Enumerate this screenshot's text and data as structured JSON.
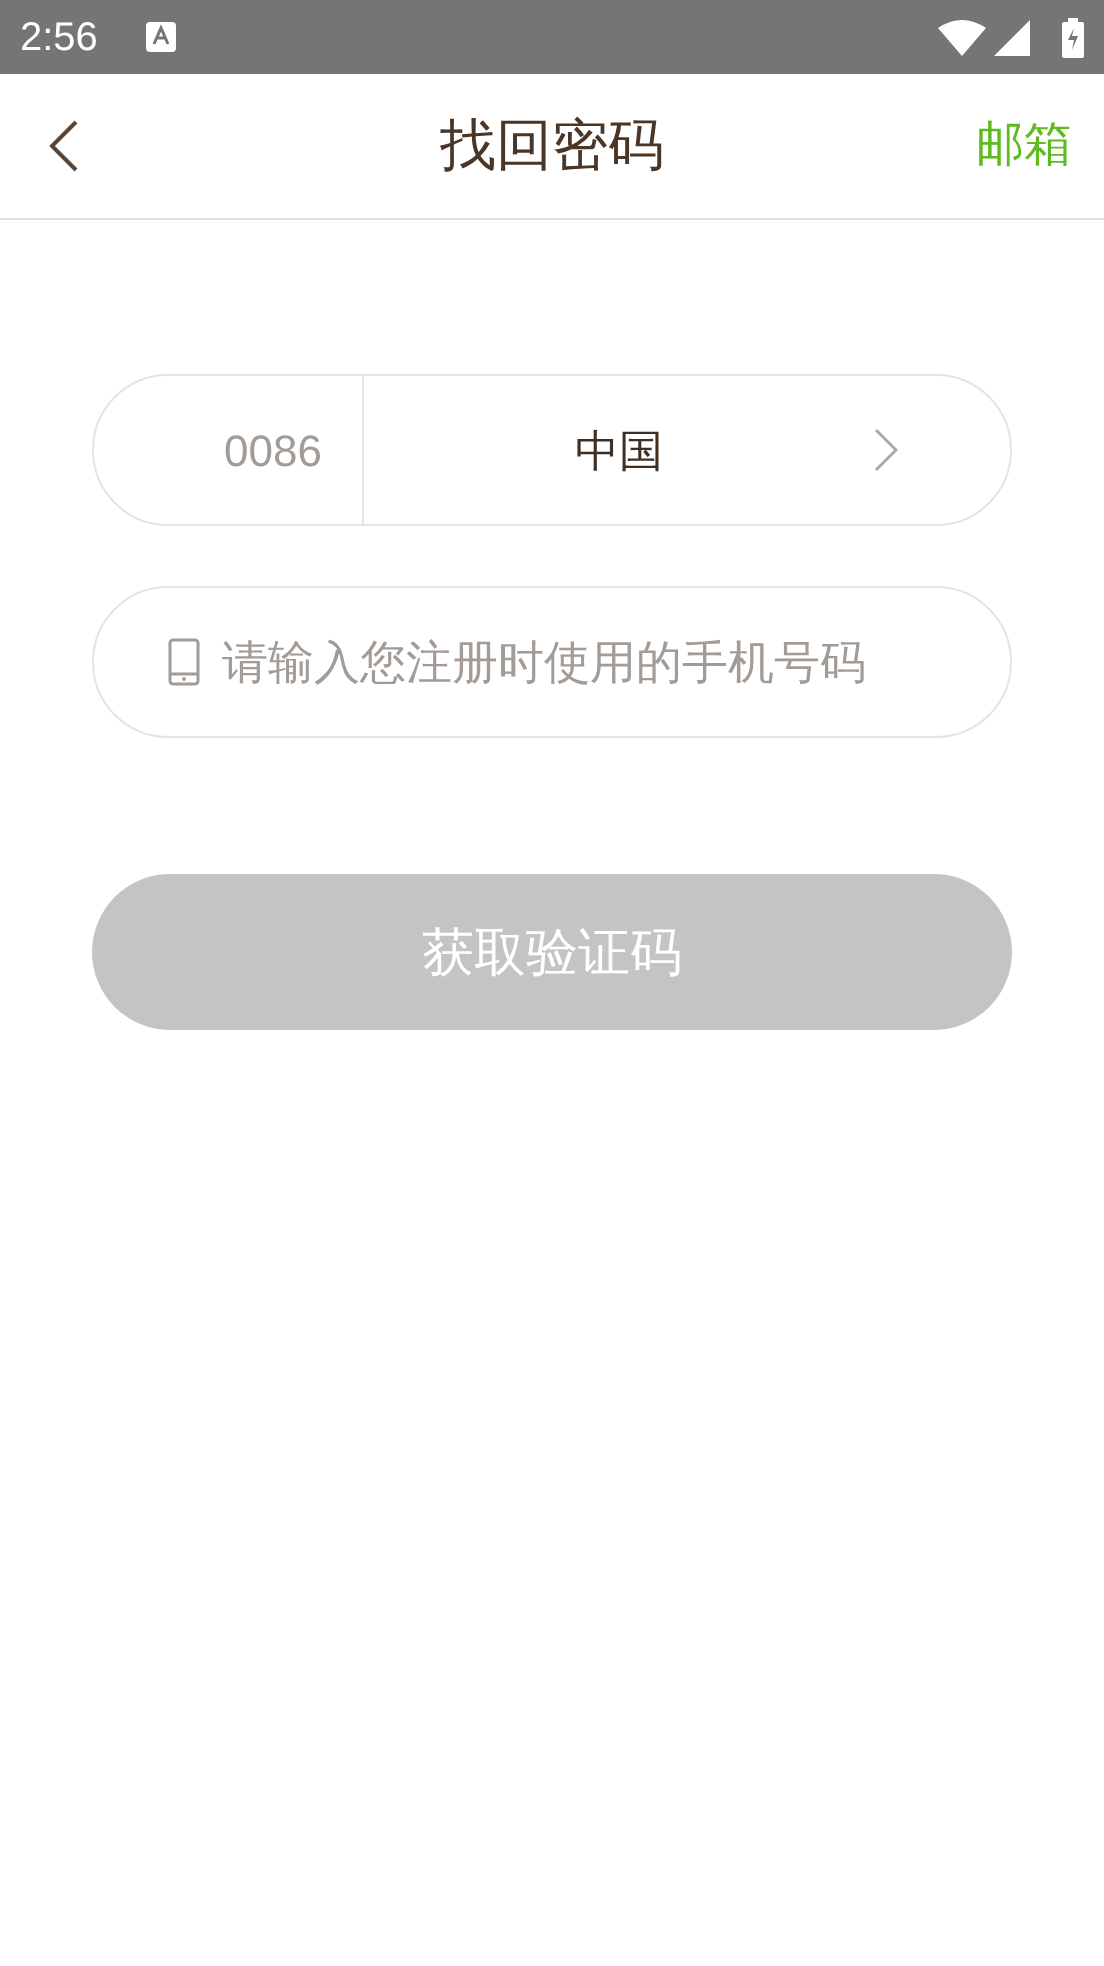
{
  "status_bar": {
    "time": "2:56"
  },
  "header": {
    "title": "找回密码",
    "action": "邮箱"
  },
  "country": {
    "code": "0086",
    "name": "中国"
  },
  "phone_field": {
    "placeholder": "请输入您注册时使用的手机号码"
  },
  "submit": {
    "label": "获取验证码",
    "disabled": true
  }
}
